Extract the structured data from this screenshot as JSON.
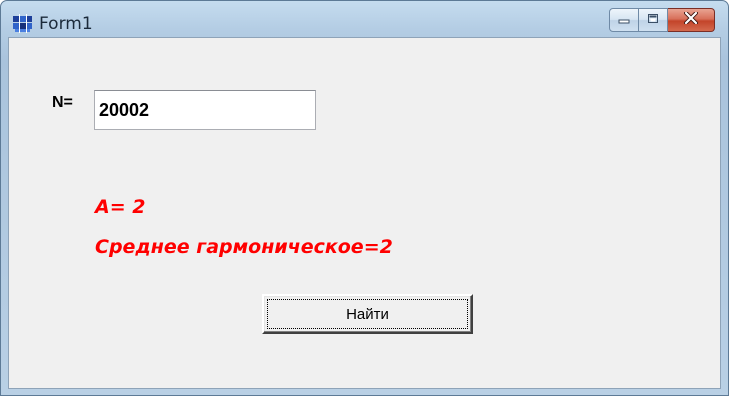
{
  "window": {
    "title": "Form1",
    "icon": "delphi-app-icon",
    "buttons": [
      "minimize-icon",
      "maximize-icon",
      "close-icon"
    ]
  },
  "form": {
    "n_label": "N=",
    "n_value": "20002",
    "result_a": "A= 2",
    "result_harmonic": "Среднее гармоническое=2",
    "find_button_label": "Найти"
  },
  "colors": {
    "result_text": "#ff0000",
    "client_bg": "#f0f0f0",
    "close_button": "#c3442a"
  }
}
